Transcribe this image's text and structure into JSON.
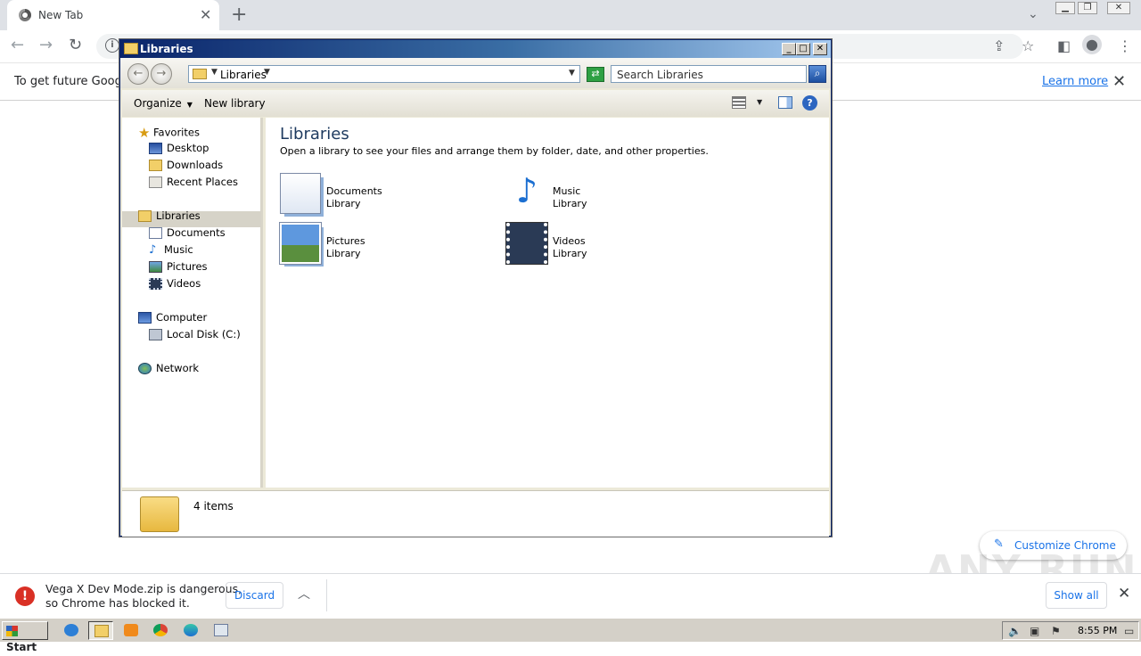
{
  "browser": {
    "tab_title": "New Tab",
    "tab_close": "✕",
    "new_tab": "+",
    "infobar_message": "To get future Google",
    "infobar_learn_more": "Learn more",
    "infobar_close": "✕"
  },
  "explorer": {
    "title": "Libraries",
    "address": "Libraries",
    "search_placeholder": "Search Libraries",
    "commands": {
      "organize": "Organize",
      "new_library": "New library"
    },
    "nav": {
      "favorites": "Favorites",
      "favorites_items": [
        "Desktop",
        "Downloads",
        "Recent Places"
      ],
      "libraries": "Libraries",
      "libraries_items": [
        "Documents",
        "Music",
        "Pictures",
        "Videos"
      ],
      "computer": "Computer",
      "computer_items": [
        "Local Disk (C:)"
      ],
      "network": "Network"
    },
    "content": {
      "heading": "Libraries",
      "subtitle": "Open a library to see your files and arrange them by folder, date, and other properties.",
      "libraries": [
        {
          "name": "Documents",
          "type": "Library",
          "icon": "documents-library-icon"
        },
        {
          "name": "Music",
          "type": "Library",
          "icon": "music-library-icon"
        },
        {
          "name": "Pictures",
          "type": "Library",
          "icon": "pictures-library-icon"
        },
        {
          "name": "Videos",
          "type": "Library",
          "icon": "videos-library-icon"
        }
      ]
    },
    "status": "4 items"
  },
  "customize_chrome": "Customize Chrome",
  "watermark": "ANY RUN",
  "download": {
    "line1": "Vega X Dev Mode.zip is dangerous,",
    "line2": "so Chrome has blocked it.",
    "discard": "Discard",
    "show_all": "Show all"
  },
  "taskbar": {
    "start": "Start",
    "clock": "8:55 PM"
  }
}
